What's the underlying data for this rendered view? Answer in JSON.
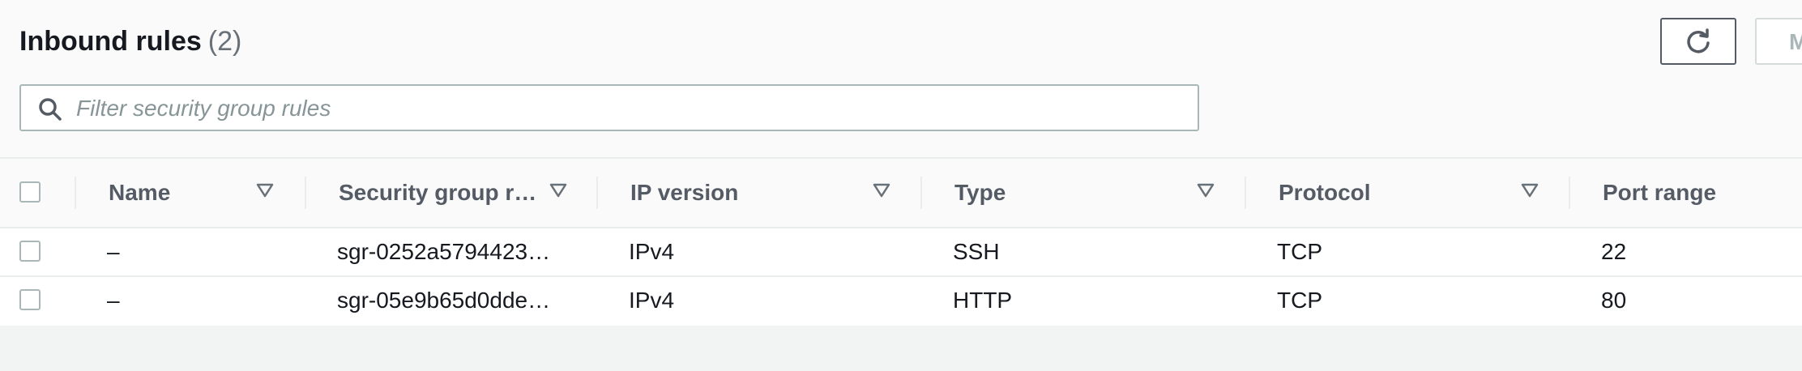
{
  "header": {
    "title": "Inbound rules",
    "count": "(2)",
    "clipped_button_label": "M"
  },
  "search": {
    "placeholder": "Filter security group rules",
    "value": ""
  },
  "columns": [
    {
      "label": "Name",
      "sortable": true
    },
    {
      "label": "Security group r…",
      "sortable": true
    },
    {
      "label": "IP version",
      "sortable": true
    },
    {
      "label": "Type",
      "sortable": true
    },
    {
      "label": "Protocol",
      "sortable": true
    },
    {
      "label": "Port range",
      "sortable": false
    }
  ],
  "rows": [
    {
      "name": "–",
      "security_group_rule_id": "sgr-0252a5794423…",
      "ip_version": "IPv4",
      "type": "SSH",
      "protocol": "TCP",
      "port_range": "22"
    },
    {
      "name": "–",
      "security_group_rule_id": "sgr-05e9b65d0dde…",
      "ip_version": "IPv4",
      "type": "HTTP",
      "protocol": "TCP",
      "port_range": "80"
    }
  ],
  "colors": {
    "text": "#16191f",
    "muted": "#687078",
    "header_text": "#545b64",
    "border": "#eaeded"
  },
  "icons": {
    "refresh": "refresh-icon",
    "search": "search-icon",
    "sort": "caret-down-icon"
  }
}
